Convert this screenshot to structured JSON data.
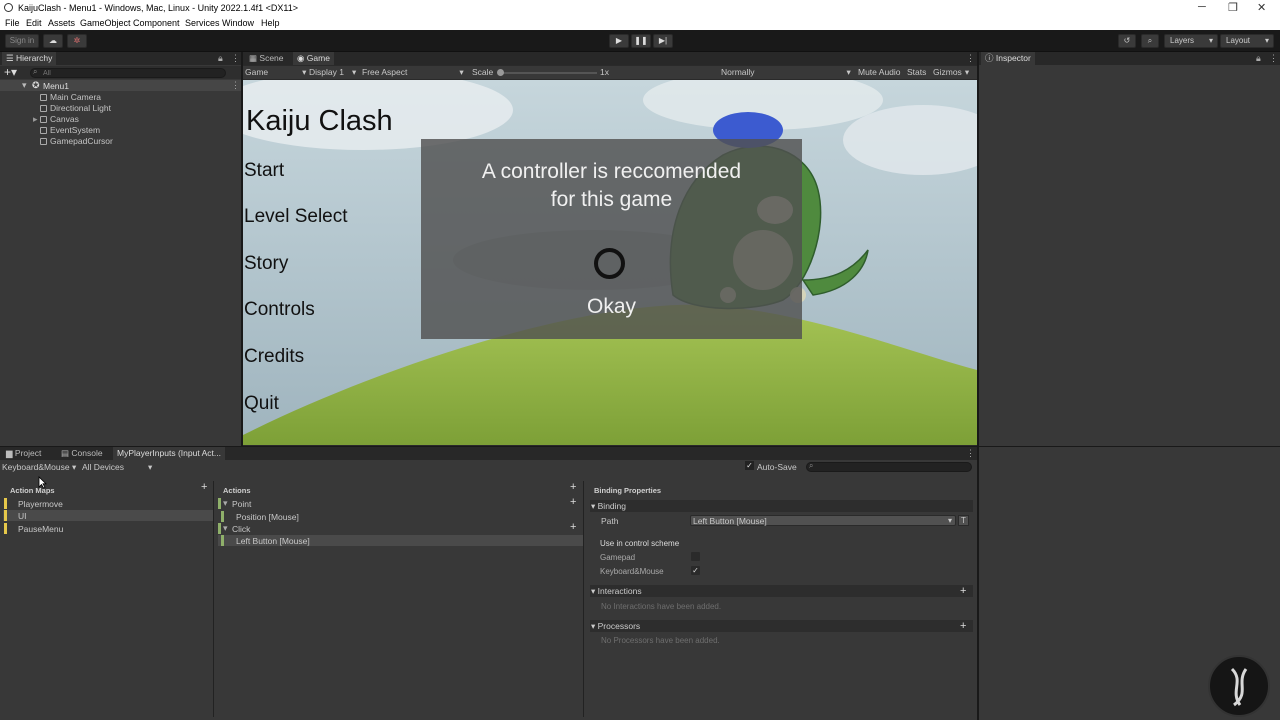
{
  "window": {
    "title": "KaijuClash - Menu1 - Windows, Mac, Linux - Unity 2022.1.4f1 <DX11>",
    "controls": [
      "─",
      "❐",
      "✕"
    ]
  },
  "menubar": [
    "File",
    "Edit",
    "Assets",
    "GameObject",
    "Component",
    "Services",
    "Window",
    "Help"
  ],
  "toolbar": {
    "sign_in": "Sign in",
    "layers": "Layers",
    "layout": "Layout"
  },
  "hierarchy": {
    "tab": "Hierarchy",
    "search_placeholder": "All",
    "scene": "Menu1",
    "items": [
      "Main Camera",
      "Directional Light",
      "Canvas",
      "EventSystem",
      "GamepadCursor"
    ]
  },
  "game_tabs": {
    "scene": "Scene",
    "game": "Game"
  },
  "game_bar": {
    "mode": "Game",
    "display": "Display 1",
    "aspect": "Free Aspect",
    "scale_label": "Scale",
    "scale_value": "1x",
    "quality": "Normally",
    "mute": "Mute Audio",
    "stats": "Stats",
    "gizmos": "Gizmos"
  },
  "game_view": {
    "title": "Kaiju Clash",
    "menu": [
      "Start",
      "Level Select",
      "Story",
      "Controls",
      "Credits",
      "Quit"
    ],
    "dialog_line1": "A controller is reccomended",
    "dialog_line2": "for this game",
    "dialog_button": "Okay"
  },
  "inspector": {
    "tab": "Inspector"
  },
  "bottom_tabs": {
    "project": "Project",
    "console": "Console",
    "inputs": "MyPlayerInputs (Input Act..."
  },
  "input_bar": {
    "scheme": "Keyboard&Mouse",
    "devices": "All Devices",
    "autosave": "Auto-Save"
  },
  "action_maps": {
    "header": "Action Maps",
    "items": [
      "Playermove",
      "UI",
      "PauseMenu"
    ]
  },
  "actions": {
    "header": "Actions",
    "point": "Point",
    "point_binding": "Position [Mouse]",
    "click": "Click",
    "click_binding": "Left Button [Mouse]"
  },
  "binding": {
    "header": "Binding Properties",
    "section": "Binding",
    "path_label": "Path",
    "path_value": "Left Button [Mouse]",
    "path_btn": "T",
    "use_in_scheme": "Use in control scheme",
    "gamepad": "Gamepad",
    "keyboard": "Keyboard&Mouse",
    "interactions": "Interactions",
    "interactions_empty": "No Interactions have been added.",
    "processors": "Processors",
    "processors_empty": "No Processors have been added."
  },
  "colors": {
    "accent_yellow": "#e6c84a",
    "accent_green": "#8fb06a",
    "panel": "#383838"
  }
}
